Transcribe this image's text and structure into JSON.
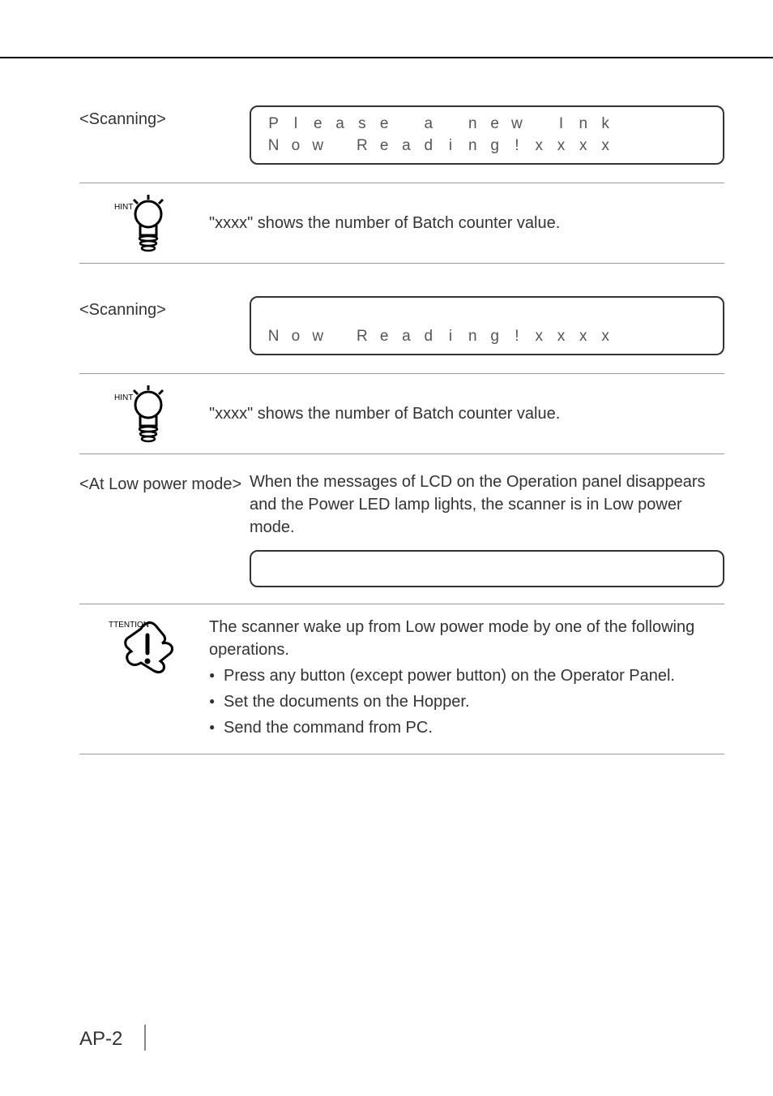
{
  "section1": {
    "heading": "<Scanning>",
    "lcd_row1": [
      "P",
      "l",
      "e",
      "a",
      "s",
      "e",
      "",
      "a",
      "",
      "n",
      "e",
      "w",
      "",
      "I",
      "n",
      "k"
    ],
    "lcd_row2": [
      "N",
      "o",
      "w",
      "",
      "R",
      "e",
      "a",
      "d",
      "i",
      "n",
      "g",
      "!",
      "x",
      "x",
      "x",
      "x"
    ],
    "hint": "\"xxxx\" shows the number of Batch counter value."
  },
  "section2": {
    "heading": "<Scanning>",
    "lcd_row1": [
      "",
      "",
      "",
      "",
      "",
      "",
      "",
      "",
      "",
      "",
      "",
      "",
      "",
      "",
      "",
      ""
    ],
    "lcd_row2": [
      "N",
      "o",
      "w",
      "",
      "R",
      "e",
      "a",
      "d",
      "i",
      "n",
      "g",
      "!",
      "x",
      "x",
      "x",
      "x"
    ],
    "hint": "\"xxxx\" shows the number of Batch counter value."
  },
  "section3": {
    "heading": "<At Low power mode>",
    "body": "When the messages of LCD on the Operation panel disappears and the Power LED lamp lights, the scanner is in Low power mode.",
    "att_intro": "The scanner wake up from Low power mode by one of the following operations.",
    "bullets": [
      "Press any button (except power button) on the Operator Panel.",
      "Set the documents on the Hopper.",
      "Send the command from PC."
    ]
  },
  "page_number": "AP-2",
  "icon_labels": {
    "hint": "HINT",
    "attention": "TTENTION"
  }
}
